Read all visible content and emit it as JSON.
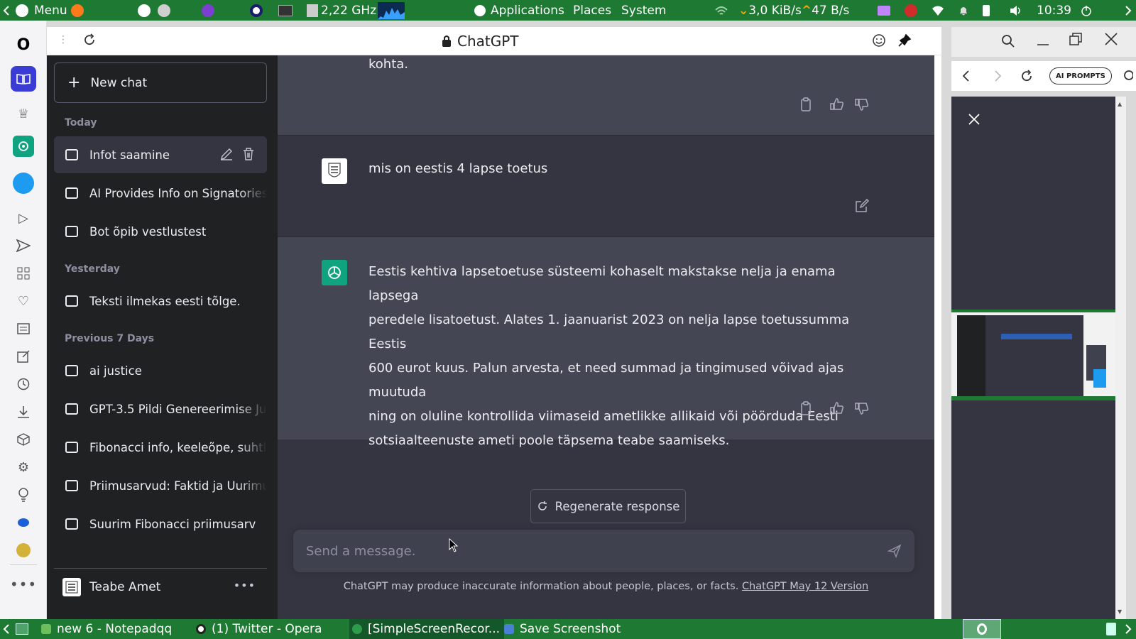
{
  "top_panel": {
    "menu_label": "Menu",
    "cpu_freq": "2,22 GHz",
    "apps": [
      "Applications",
      "Places",
      "System"
    ],
    "net_down": "3,0 KiB/s",
    "net_up": "47 B/s",
    "clock": "10:39"
  },
  "browser": {
    "title": "ChatGPT"
  },
  "sidebar": {
    "new_chat": "New chat",
    "sections": [
      {
        "label": "Today",
        "items": [
          "Infot saamine",
          "AI Provides Info on Signatories",
          "Bot õpib vestlustest"
        ]
      },
      {
        "label": "Yesterday",
        "items": [
          "Teksti ilmekas eesti tõlge."
        ]
      },
      {
        "label": "Previous 7 Days",
        "items": [
          "ai justice",
          "GPT-3.5 Pildi Genereerimise Ju",
          "Fibonacci info, keeleõpe, suhtl",
          "Priimusarvud: Faktid ja Uurimu",
          "Suurim Fibonacci priimusarv"
        ]
      }
    ],
    "user_name": "Teabe Amet"
  },
  "conversation": {
    "partial_top": "kohta.",
    "user_message": "mis on eestis 4 lapse toetus",
    "bot_message_lines": [
      "Eestis kehtiva lapsetoetuse süsteemi kohaselt makstakse nelja ja enama lapsega",
      "peredele lisatoetust. Alates 1. jaanuarist 2023 on nelja lapse toetussumma Eestis",
      "600 eurot kuus. Palun arvesta, et need summad ja tingimused võivad ajas muutuda",
      "ning on oluline kontrollida viimaseid ametlikke allikaid või pöörduda Eesti",
      "sotsiaalteenuste ameti poole täpsema teabe saamiseks."
    ],
    "regenerate": "Regenerate response",
    "input_placeholder": "Send a message.",
    "disclaimer": "ChatGPT may produce inaccurate information about people, places, or facts. ",
    "version_link": "ChatGPT May 12 Version"
  },
  "right_panel": {
    "prompts_button": "AI PROMPTS"
  },
  "taskbar": {
    "items": [
      "new 6 - Notepadqq",
      "(1) Twitter - Opera",
      "[SimpleScreenRecor...",
      "Save Screenshot"
    ]
  },
  "colors": {
    "panel_green": "#1e7a32",
    "chatgpt_green": "#10a37f",
    "sidebar_bg": "#202123",
    "main_bg": "#343541",
    "bot_bg": "#444654"
  }
}
